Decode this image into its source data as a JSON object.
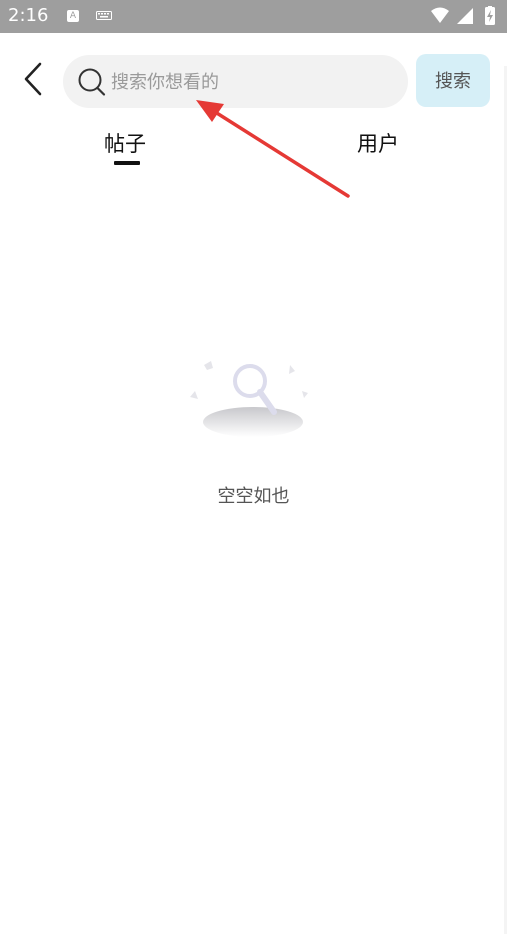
{
  "status_bar": {
    "time": "2:16",
    "a_badge": "A"
  },
  "search": {
    "placeholder": "搜索你想看的",
    "value": "",
    "button_label": "搜索"
  },
  "tabs": [
    {
      "label": "帖子",
      "active": true
    },
    {
      "label": "用户",
      "active": false
    }
  ],
  "empty_state": {
    "message": "空空如也"
  },
  "colors": {
    "status_bar_bg": "#9e9e9e",
    "search_bg": "#f2f2f2",
    "search_button_bg": "#d6eff7",
    "annotation_arrow": "#e53935"
  },
  "icons": {
    "back": "chevron-left-icon",
    "search": "search-icon",
    "empty": "empty-search-illustration"
  }
}
